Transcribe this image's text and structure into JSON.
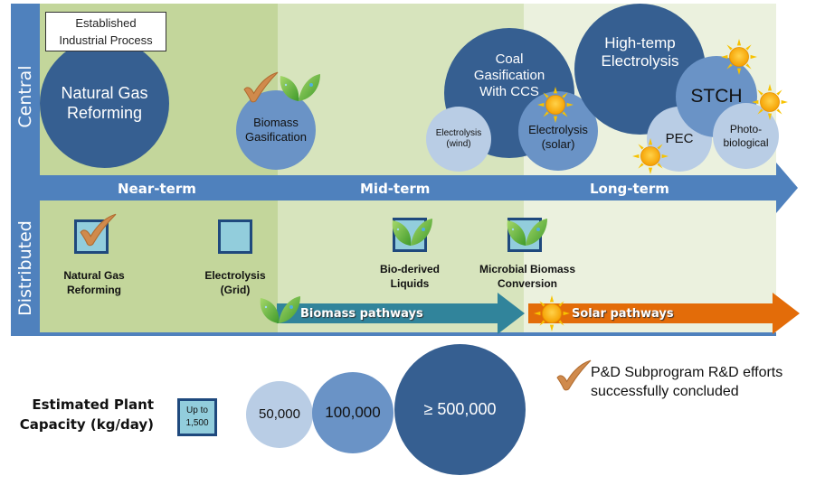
{
  "legend_box": {
    "established": "Established Industrial Process"
  },
  "rows": {
    "central": "Central",
    "distributed": "Distributed"
  },
  "timeline": {
    "near": "Near-term",
    "mid": "Mid-term",
    "long": "Long-term"
  },
  "central": {
    "ngr": "Natural Gas Reforming",
    "biomass_gas": "Biomass Gasification",
    "coal": "Coal Gasification With CCS",
    "elec_wind": "Electrolysis (wind)",
    "elec_solar": "Electrolysis (solar)",
    "hte": "High-temp Electrolysis",
    "stch": "STCH",
    "pec": "PEC",
    "photobio": "Photo-biological"
  },
  "distributed": {
    "ngr": "Natural Gas Reforming",
    "elec_grid": "Electrolysis (Grid)",
    "bio_liquids": "Bio-derived Liquids",
    "microbial": "Microbial Biomass Conversion"
  },
  "pathways": {
    "biomass": "Biomass pathways",
    "solar": "Solar pathways"
  },
  "capacity": {
    "label": "Estimated Plant Capacity (kg/day)",
    "distributed": "Up to 1,500",
    "small": "50,000",
    "medium": "100,000",
    "large": "≥ 500,000"
  },
  "legend": {
    "check": "P&D Subprogram R&D efforts successfully concluded"
  },
  "colors": {
    "dark": "#365f91",
    "mid": "#6a93c6",
    "light": "#b9cde5",
    "biomass_arrow": "#31849b",
    "solar_arrow": "#e36c09",
    "check": "#d08a4c"
  }
}
